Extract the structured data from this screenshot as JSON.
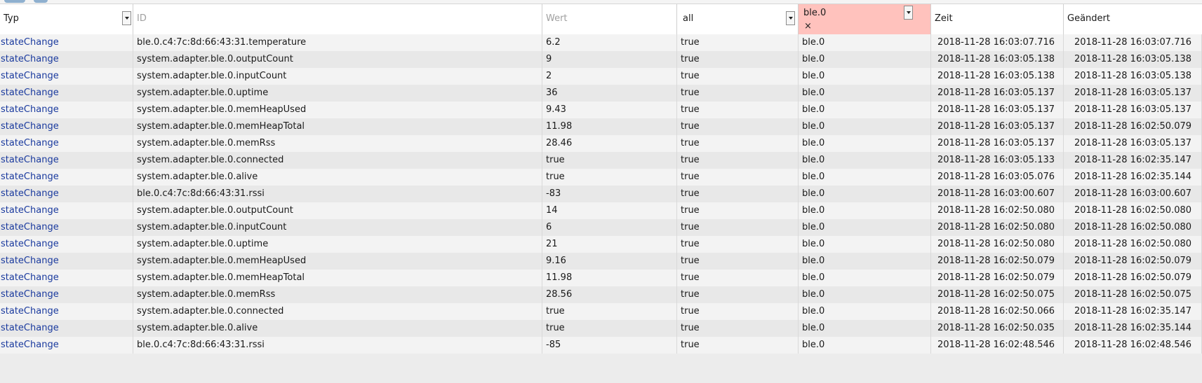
{
  "header": {
    "typ_label": "Typ",
    "id_placeholder": "ID",
    "wert_placeholder": "Wert",
    "ack_filter": "all",
    "from_filter": "ble.0",
    "clear_symbol": "×",
    "zeit_label": "Zeit",
    "geaendert_label": "Geändert"
  },
  "rows": [
    {
      "typ": "stateChange",
      "id": "ble.0.c4:7c:8d:66:43:31.temperature",
      "wert": "6.2",
      "ack": "true",
      "from": "ble.0",
      "zeit": "2018-11-28 16:03:07.716",
      "geaendert": "2018-11-28 16:03:07.716"
    },
    {
      "typ": "stateChange",
      "id": "system.adapter.ble.0.outputCount",
      "wert": "9",
      "ack": "true",
      "from": "ble.0",
      "zeit": "2018-11-28 16:03:05.138",
      "geaendert": "2018-11-28 16:03:05.138"
    },
    {
      "typ": "stateChange",
      "id": "system.adapter.ble.0.inputCount",
      "wert": "2",
      "ack": "true",
      "from": "ble.0",
      "zeit": "2018-11-28 16:03:05.138",
      "geaendert": "2018-11-28 16:03:05.138"
    },
    {
      "typ": "stateChange",
      "id": "system.adapter.ble.0.uptime",
      "wert": "36",
      "ack": "true",
      "from": "ble.0",
      "zeit": "2018-11-28 16:03:05.137",
      "geaendert": "2018-11-28 16:03:05.137"
    },
    {
      "typ": "stateChange",
      "id": "system.adapter.ble.0.memHeapUsed",
      "wert": "9.43",
      "ack": "true",
      "from": "ble.0",
      "zeit": "2018-11-28 16:03:05.137",
      "geaendert": "2018-11-28 16:03:05.137"
    },
    {
      "typ": "stateChange",
      "id": "system.adapter.ble.0.memHeapTotal",
      "wert": "11.98",
      "ack": "true",
      "from": "ble.0",
      "zeit": "2018-11-28 16:03:05.137",
      "geaendert": "2018-11-28 16:02:50.079"
    },
    {
      "typ": "stateChange",
      "id": "system.adapter.ble.0.memRss",
      "wert": "28.46",
      "ack": "true",
      "from": "ble.0",
      "zeit": "2018-11-28 16:03:05.137",
      "geaendert": "2018-11-28 16:03:05.137"
    },
    {
      "typ": "stateChange",
      "id": "system.adapter.ble.0.connected",
      "wert": "true",
      "ack": "true",
      "from": "ble.0",
      "zeit": "2018-11-28 16:03:05.133",
      "geaendert": "2018-11-28 16:02:35.147"
    },
    {
      "typ": "stateChange",
      "id": "system.adapter.ble.0.alive",
      "wert": "true",
      "ack": "true",
      "from": "ble.0",
      "zeit": "2018-11-28 16:03:05.076",
      "geaendert": "2018-11-28 16:02:35.144"
    },
    {
      "typ": "stateChange",
      "id": "ble.0.c4:7c:8d:66:43:31.rssi",
      "wert": "-83",
      "ack": "true",
      "from": "ble.0",
      "zeit": "2018-11-28 16:03:00.607",
      "geaendert": "2018-11-28 16:03:00.607"
    },
    {
      "typ": "stateChange",
      "id": "system.adapter.ble.0.outputCount",
      "wert": "14",
      "ack": "true",
      "from": "ble.0",
      "zeit": "2018-11-28 16:02:50.080",
      "geaendert": "2018-11-28 16:02:50.080"
    },
    {
      "typ": "stateChange",
      "id": "system.adapter.ble.0.inputCount",
      "wert": "6",
      "ack": "true",
      "from": "ble.0",
      "zeit": "2018-11-28 16:02:50.080",
      "geaendert": "2018-11-28 16:02:50.080"
    },
    {
      "typ": "stateChange",
      "id": "system.adapter.ble.0.uptime",
      "wert": "21",
      "ack": "true",
      "from": "ble.0",
      "zeit": "2018-11-28 16:02:50.080",
      "geaendert": "2018-11-28 16:02:50.080"
    },
    {
      "typ": "stateChange",
      "id": "system.adapter.ble.0.memHeapUsed",
      "wert": "9.16",
      "ack": "true",
      "from": "ble.0",
      "zeit": "2018-11-28 16:02:50.079",
      "geaendert": "2018-11-28 16:02:50.079"
    },
    {
      "typ": "stateChange",
      "id": "system.adapter.ble.0.memHeapTotal",
      "wert": "11.98",
      "ack": "true",
      "from": "ble.0",
      "zeit": "2018-11-28 16:02:50.079",
      "geaendert": "2018-11-28 16:02:50.079"
    },
    {
      "typ": "stateChange",
      "id": "system.adapter.ble.0.memRss",
      "wert": "28.56",
      "ack": "true",
      "from": "ble.0",
      "zeit": "2018-11-28 16:02:50.075",
      "geaendert": "2018-11-28 16:02:50.075"
    },
    {
      "typ": "stateChange",
      "id": "system.adapter.ble.0.connected",
      "wert": "true",
      "ack": "true",
      "from": "ble.0",
      "zeit": "2018-11-28 16:02:50.066",
      "geaendert": "2018-11-28 16:02:35.147"
    },
    {
      "typ": "stateChange",
      "id": "system.adapter.ble.0.alive",
      "wert": "true",
      "ack": "true",
      "from": "ble.0",
      "zeit": "2018-11-28 16:02:50.035",
      "geaendert": "2018-11-28 16:02:35.144"
    },
    {
      "typ": "stateChange",
      "id": "ble.0.c4:7c:8d:66:43:31.rssi",
      "wert": "-85",
      "ack": "true",
      "from": "ble.0",
      "zeit": "2018-11-28 16:02:48.546",
      "geaendert": "2018-11-28 16:02:48.546"
    }
  ]
}
